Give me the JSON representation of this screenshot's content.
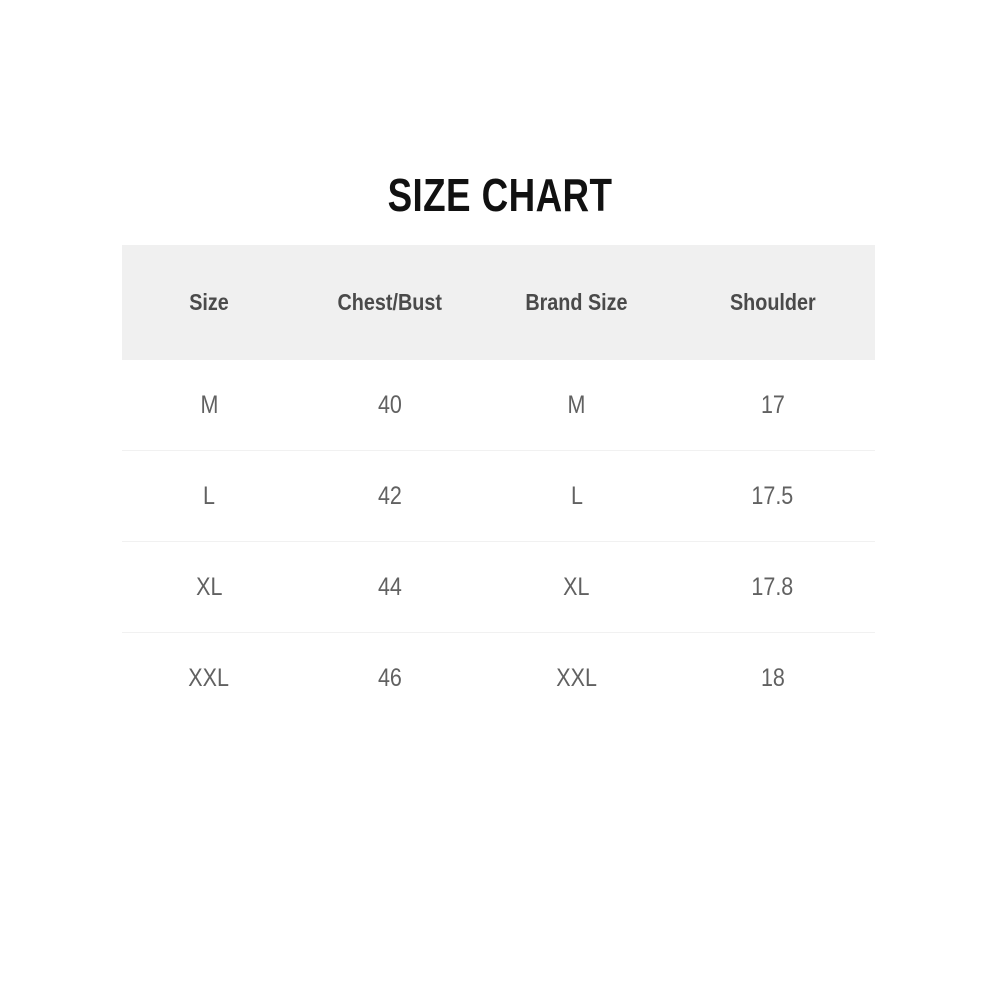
{
  "title": "SIZE CHART",
  "colors": {
    "title_text": "#111111",
    "header_background": "#f0f0f0",
    "header_text": "#4a4a4a",
    "cell_text": "#616161",
    "row_divider": "#f1f1f1",
    "page_background": "#ffffff"
  },
  "chart_data": {
    "type": "table",
    "title": "SIZE CHART",
    "columns": [
      "Size",
      "Chest/Bust",
      "Brand Size",
      "Shoulder"
    ],
    "rows": [
      [
        "M",
        "40",
        "M",
        "17"
      ],
      [
        "L",
        "42",
        "L",
        "17.5"
      ],
      [
        "XL",
        "44",
        "XL",
        "17.8"
      ],
      [
        "XXL",
        "46",
        "XXL",
        "18"
      ]
    ]
  },
  "table": {
    "headers": [
      {
        "label": "Size"
      },
      {
        "label": "Chest/Bust"
      },
      {
        "label": "Brand Size"
      },
      {
        "label": "Shoulder"
      }
    ],
    "rows": [
      {
        "size": "M",
        "chest_bust": "40",
        "brand_size": "M",
        "shoulder": "17"
      },
      {
        "size": "L",
        "chest_bust": "42",
        "brand_size": "L",
        "shoulder": "17.5"
      },
      {
        "size": "XL",
        "chest_bust": "44",
        "brand_size": "XL",
        "shoulder": "17.8"
      },
      {
        "size": "XXL",
        "chest_bust": "46",
        "brand_size": "XXL",
        "shoulder": "18"
      }
    ]
  }
}
